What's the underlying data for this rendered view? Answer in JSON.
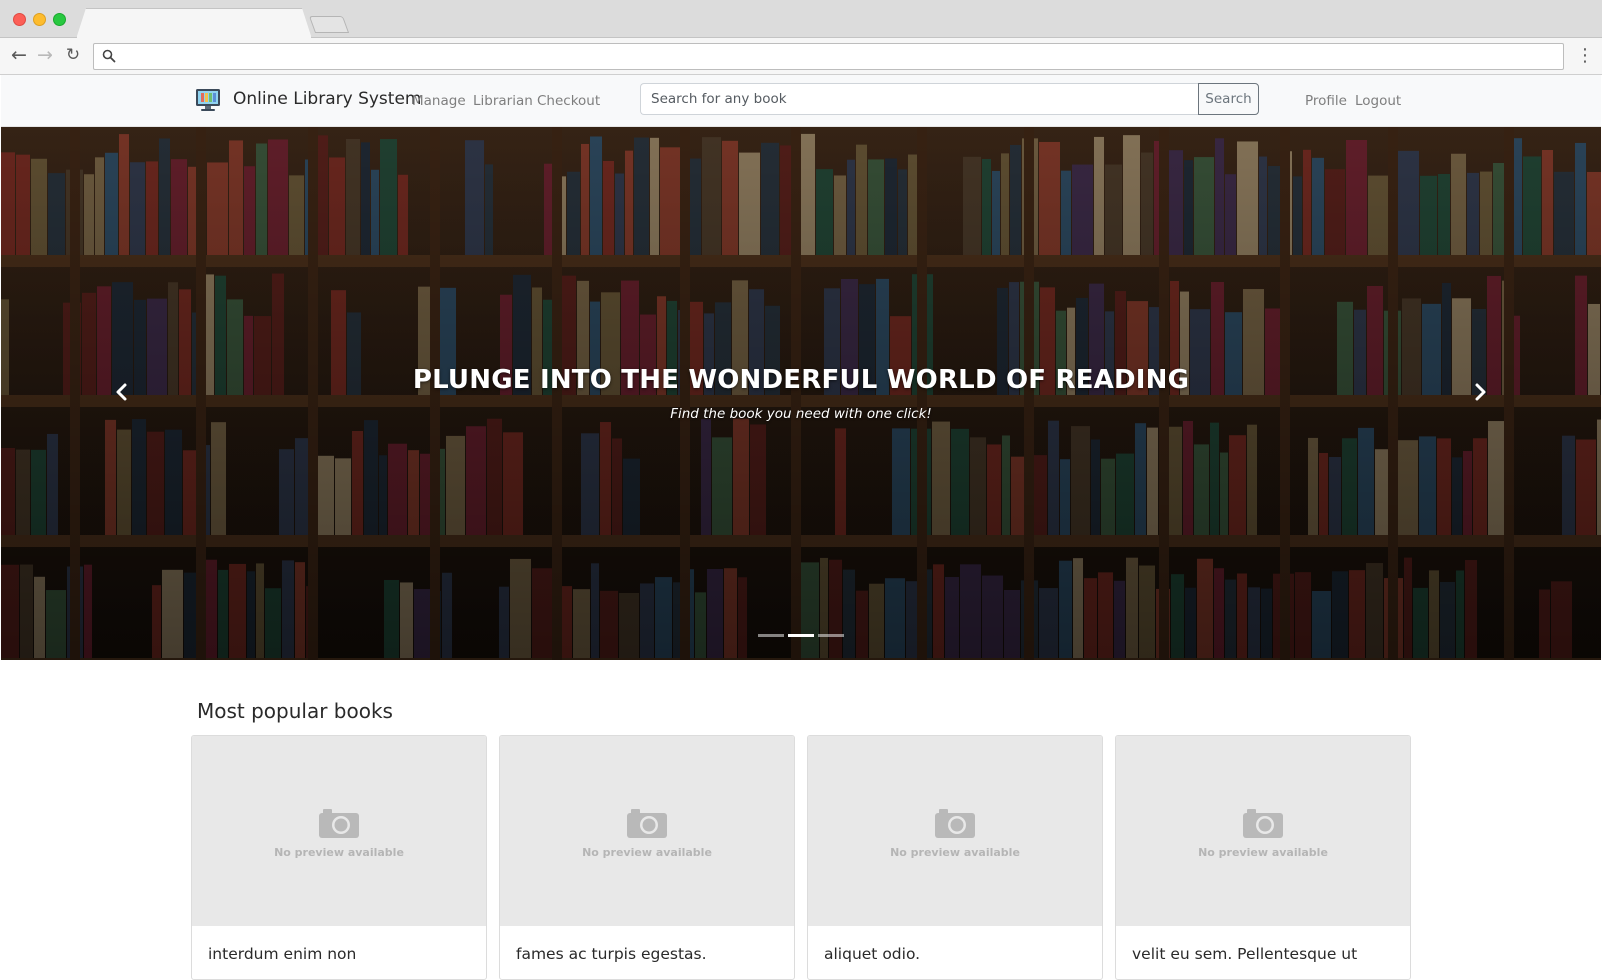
{
  "browser": {
    "tab_title": "",
    "address": "",
    "icons": {
      "back": "arrow-left-icon",
      "forward": "arrow-right-icon",
      "reload": "reload-icon",
      "search": "search-icon",
      "menu": "kebab-menu-icon"
    }
  },
  "navbar": {
    "brand": "Online Library System",
    "brand_icon": "computer-monitor-icon",
    "links": [
      "Manage",
      "Librarian",
      "Checkout"
    ],
    "search_placeholder": "Search for any book",
    "search_button": "Search",
    "user_links": [
      "Profile",
      "Logout"
    ]
  },
  "hero": {
    "title": "PLUNGE INTO THE WONDERFUL WORLD OF READING",
    "subtitle": "Find the book you need with one click!",
    "background": "library-bookshelves-photo",
    "active_slide": 2,
    "slide_count": 3
  },
  "books": {
    "heading": "Most popular books",
    "placeholder_text": "No preview available",
    "items": [
      {
        "title": "interdum enim non"
      },
      {
        "title": "fames ac turpis egestas."
      },
      {
        "title": "aliquet odio."
      },
      {
        "title": "velit eu sem. Pellentesque ut"
      }
    ]
  },
  "colors": {
    "navbar_bg": "#f8f9fa",
    "nav_link": "#7e7e7e",
    "card_image_bg": "#e8e8e8",
    "search_button_border": "#6c757d"
  }
}
